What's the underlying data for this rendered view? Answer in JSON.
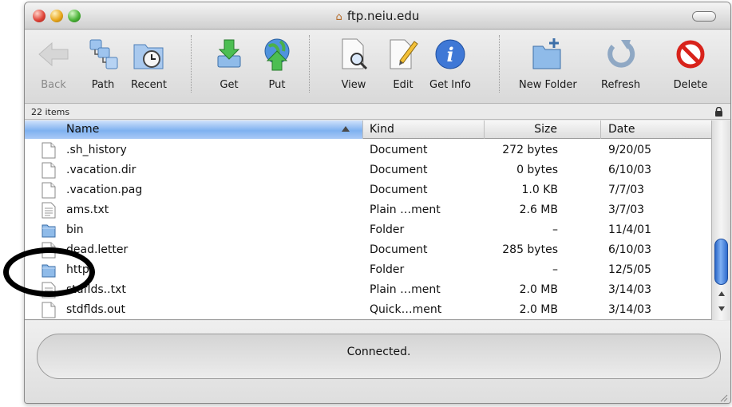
{
  "window": {
    "title": "ftp.neiu.edu",
    "title_icon": "home-icon"
  },
  "toolbar": {
    "back": "Back",
    "path": "Path",
    "recent": "Recent",
    "get": "Get",
    "put": "Put",
    "view": "View",
    "edit": "Edit",
    "get_info": "Get Info",
    "new_folder": "New Folder",
    "refresh": "Refresh",
    "delete": "Delete"
  },
  "info_bar": {
    "item_count": "22 items"
  },
  "columns": {
    "name": "Name",
    "kind": "Kind",
    "size": "Size",
    "date": "Date"
  },
  "files": [
    {
      "name": ".sh_history",
      "kind": "Document",
      "size": "272 bytes",
      "date": "9/20/05",
      "icon": "document-icon"
    },
    {
      "name": ".vacation.dir",
      "kind": "Document",
      "size": "0 bytes",
      "date": "6/10/03",
      "icon": "document-icon"
    },
    {
      "name": ".vacation.pag",
      "kind": "Document",
      "size": "1.0 KB",
      "date": "7/7/03",
      "icon": "document-icon"
    },
    {
      "name": "ams.txt",
      "kind": "Plain …ment",
      "size": "2.6 MB",
      "date": "3/7/03",
      "icon": "text-document-icon"
    },
    {
      "name": "bin",
      "kind": "Folder",
      "size": "–",
      "date": "11/4/01",
      "icon": "folder-icon"
    },
    {
      "name": "dead.letter",
      "kind": "Document",
      "size": "285 bytes",
      "date": "6/10/03",
      "icon": "document-icon"
    },
    {
      "name": "http",
      "kind": "Folder",
      "size": "–",
      "date": "12/5/05",
      "icon": "folder-icon"
    },
    {
      "name": "stdflds..txt",
      "kind": "Plain …ment",
      "size": "2.0 MB",
      "date": "3/14/03",
      "icon": "text-document-icon"
    },
    {
      "name": "stdflds.out",
      "kind": "Quick…ment",
      "size": "2.0 MB",
      "date": "3/14/03",
      "icon": "document-icon"
    }
  ],
  "status": {
    "text": "Connected."
  },
  "colors": {
    "header_selected": "#7fb1f0",
    "scroll_thumb": "#2b67c7",
    "folder": "#6aa7e6"
  }
}
